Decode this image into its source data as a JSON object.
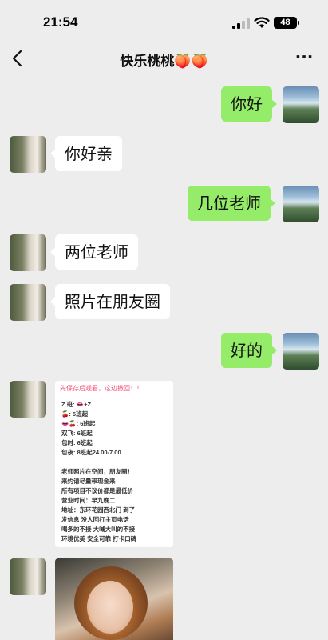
{
  "status_bar": {
    "time": "21:54",
    "battery": "48"
  },
  "nav": {
    "title": "快乐桃桃🍑🍑",
    "more": "···"
  },
  "messages": [
    {
      "side": "right",
      "text": "你好"
    },
    {
      "side": "left",
      "text": "你好亲"
    },
    {
      "side": "right",
      "text": "几位老师"
    },
    {
      "side": "left",
      "text": "两位老师"
    },
    {
      "side": "left",
      "text": "照片在朋友圈"
    },
    {
      "side": "right",
      "text": "好的"
    }
  ],
  "info_card": {
    "header": "先保存后观看，这边撤回！！",
    "lines": [
      "Z 班:  👄+Z",
      "🍒:  5班起",
      "👄🍒:  6班起",
      "双飞:  6班起",
      "包时:  6班起",
      "包夜:  8班起24.00-7.00",
      "",
      "老师照片在空间，朋友圈！",
      "来约请尽量带现金来",
      "所有项目不议价都是最低价",
      "营业时间：早九晚二",
      "地址：东环花园西北门 到了",
      "发信息 没人回打主页电话",
      "喝多的不接 大喊大叫的不接",
      "环境优美 安全可靠 打卡口碑"
    ]
  },
  "colors": {
    "bg": "#ededed",
    "sent_bubble": "#95ec69",
    "received_bubble": "#ffffff"
  }
}
